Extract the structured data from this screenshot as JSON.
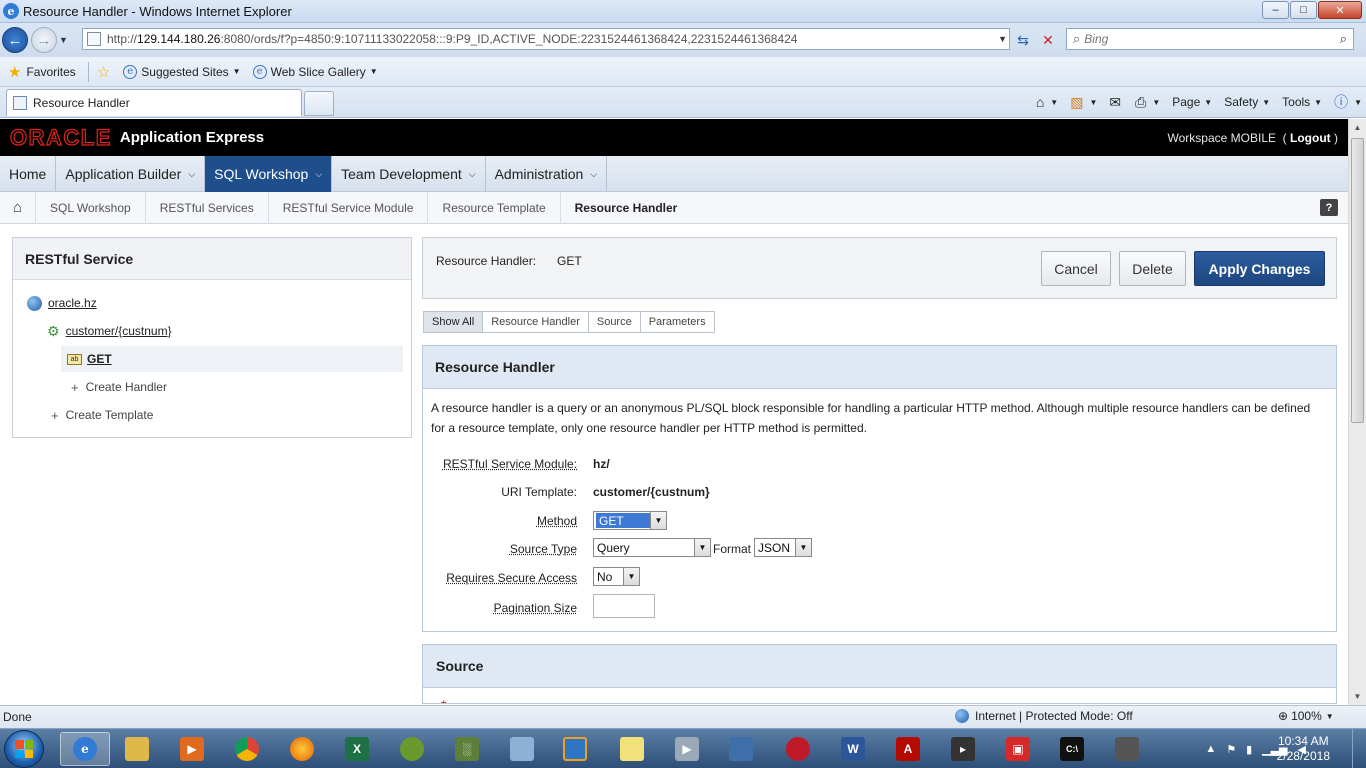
{
  "window": {
    "title": "Resource Handler - Windows Internet Explorer"
  },
  "browser": {
    "url_prefix": "http://",
    "url_host": "129.144.180.26",
    "url_rest": ":8080/ords/f?p=4850:9:10711133022058:::9:P9_ID,ACTIVE_NODE:2231524461368424,2231524461368424",
    "search_placeholder": "Bing",
    "favorites_label": "Favorites",
    "suggested_sites": "Suggested Sites",
    "web_slice_gallery": "Web Slice Gallery",
    "tab_title": "Resource Handler",
    "cmd_page": "Page",
    "cmd_safety": "Safety",
    "cmd_tools": "Tools"
  },
  "apex": {
    "brand": "ORACLE",
    "product": "Application Express",
    "workspace": "Workspace MOBILE",
    "logout": "Logout"
  },
  "nav": [
    {
      "label": "Home"
    },
    {
      "label": "Application Builder"
    },
    {
      "label": "SQL Workshop"
    },
    {
      "label": "Team Development"
    },
    {
      "label": "Administration"
    }
  ],
  "breadcrumb": [
    "SQL Workshop",
    "RESTful Services",
    "RESTful Service Module",
    "Resource Template",
    "Resource Handler"
  ],
  "left_panel": {
    "title": "RESTful Service",
    "module": "oracle.hz",
    "template": "customer/{custnum}",
    "handler": "GET",
    "create_handler": "Create Handler",
    "create_template": "Create Template"
  },
  "header_bar": {
    "label": "Resource Handler:",
    "value": "GET",
    "cancel": "Cancel",
    "delete": "Delete",
    "apply": "Apply Changes"
  },
  "subtabs": [
    "Show All",
    "Resource Handler",
    "Source",
    "Parameters"
  ],
  "region": {
    "title": "Resource Handler",
    "description": "A resource handler is a query or an anonymous PL/SQL block responsible for handling a particular HTTP method. Although multiple resource handlers can be defined for a resource template, only one resource handler per HTTP method is permitted.",
    "module_label": "RESTful Service Module:",
    "module_value": "hz/",
    "uri_label": "URI Template:",
    "uri_value": "customer/{custnum}",
    "method_label": "Method",
    "method_value": "GET",
    "source_type_label": "Source Type",
    "source_type_value": "Query",
    "format_label": "Format",
    "format_value": "JSON",
    "secure_label": "Requires Secure Access",
    "secure_value": "No",
    "pagination_label": "Pagination Size",
    "pagination_value": ""
  },
  "source_region": {
    "title": "Source"
  },
  "status": {
    "text": "Done",
    "zone": "Internet | Protected Mode: Off",
    "zoom": "100%"
  },
  "clock": {
    "time": "10:34 AM",
    "date": "2/28/2018"
  },
  "colors": {
    "accent": "#1f4e8c",
    "oracle_red": "#e0231a",
    "region_head": "#dfe8f3"
  }
}
